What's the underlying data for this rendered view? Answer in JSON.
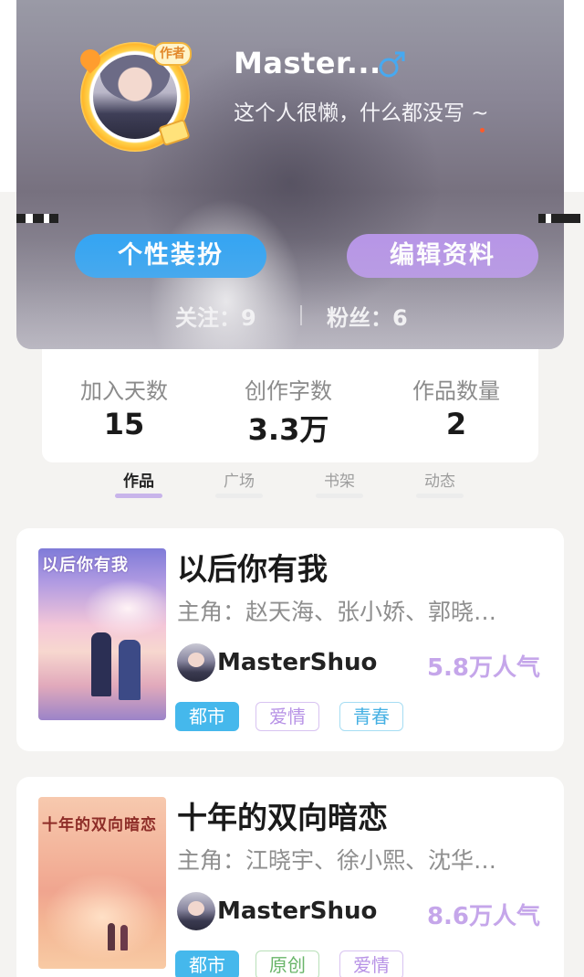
{
  "profile": {
    "username": "Master...",
    "gender_icon": "male-icon",
    "bio": "这个人很懒，什么都没写 ~",
    "avatar_badge": "作者",
    "dress_button": "个性装扮",
    "edit_button": "编辑资料",
    "following_label": "关注：9",
    "fans_label": "粉丝：6"
  },
  "stats": {
    "days_label": "加入天数",
    "days_value": "15",
    "words_label": "创作字数",
    "words_value": "3.3万",
    "works_label": "作品数量",
    "works_value": "2"
  },
  "tabs": [
    {
      "label": "作品",
      "active": true
    },
    {
      "label": "广场",
      "active": false
    },
    {
      "label": "书架",
      "active": false
    },
    {
      "label": "动态",
      "active": false
    }
  ],
  "books": [
    {
      "cover_title": "以后你有我",
      "title": "以后你有我",
      "roles": "主角：赵天海、张小娇、郭晓…",
      "author": "MasterShuo",
      "popularity": "5.8万人气",
      "tags": [
        "都市",
        "爱情",
        "青春"
      ]
    },
    {
      "cover_title": "十年的双向暗恋",
      "title": "十年的双向暗恋",
      "roles": "主角：江晓宇、徐小熙、沈华…",
      "author": "MasterShuo",
      "popularity": "8.6万人气",
      "tags": [
        "都市",
        "原创",
        "爱情"
      ]
    }
  ],
  "colors": {
    "accent_blue": "#36a5f2",
    "accent_purple": "#b796e6",
    "popularity": "#c5a6ea"
  }
}
